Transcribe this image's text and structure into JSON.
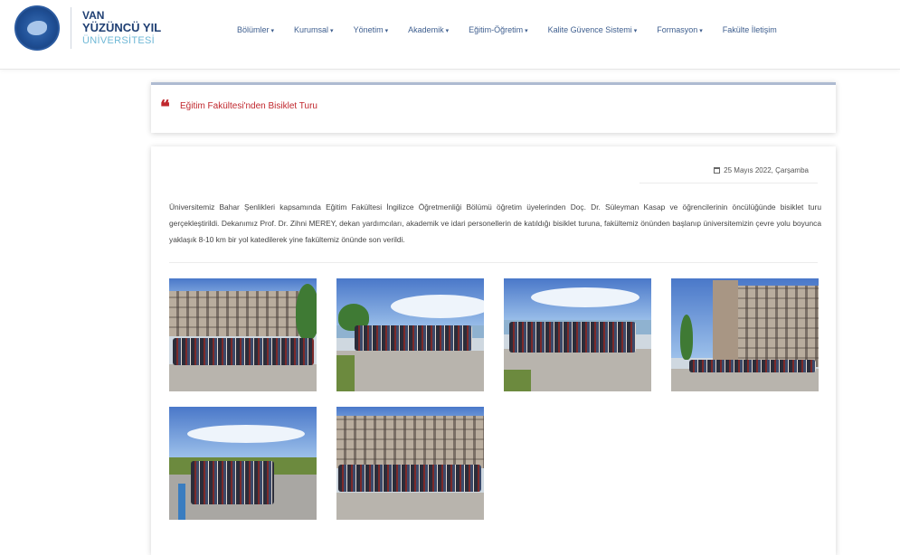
{
  "logo": {
    "line1": "VAN",
    "line2": "YÜZÜNCÜ YIL",
    "line3": "ÜNİVERSİTESİ"
  },
  "nav": {
    "items": [
      {
        "label": "Bölümler",
        "caret": "▾"
      },
      {
        "label": "Kurumsal",
        "caret": "▾"
      },
      {
        "label": "Yönetim",
        "caret": "▾"
      },
      {
        "label": "Akademik",
        "caret": "▾"
      },
      {
        "label": "Eğitim-Öğretim",
        "caret": "▾"
      },
      {
        "label": "Kalite Güvence Sistemi",
        "caret": "▾"
      },
      {
        "label": "Formasyon",
        "caret": "▾"
      },
      {
        "label": "Fakülte İletişim",
        "caret": ""
      }
    ]
  },
  "article": {
    "title": "Eğitim Fakültesi'nden Bisiklet Turu",
    "quote_glyph": "❝",
    "date": "25 Mayıs 2022, Çarşamba",
    "body": "Üniversitemiz Bahar Şenlikleri kapsamında Eğitim Fakültesi İngilizce Öğretmenliği Bölümü öğretim üyelerinden Doç. Dr. Süleyman Kasap ve öğrencilerinin öncülüğünde bisiklet turu gerçekleştirildi. Dekanımız Prof. Dr. Zihni MEREY, dekan yardımcıları, akademik ve idari personellerin de katıldığı bisiklet turuna, fakültemiz önünden başlanıp üniversitemizin çevre yolu boyunca yaklaşık 8-10 km bir yol katedilerek yine fakültemiz önünde son verildi."
  },
  "gallery": {
    "photo_count_visible": 6
  },
  "colors": {
    "accent_red": "#c0272d",
    "nav_blue": "#3f5f8f",
    "brand_navy": "#1f3f73"
  }
}
